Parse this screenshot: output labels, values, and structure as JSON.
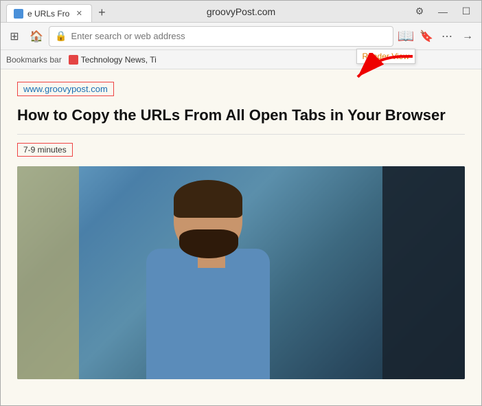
{
  "browser": {
    "title": "groovyPost.com",
    "tab": {
      "title": "e URLs Fro",
      "favicon_color": "#4a90d9"
    },
    "new_tab_label": "+",
    "window_controls": {
      "minimize": "—",
      "maximize": "☐",
      "restore": ""
    }
  },
  "toolbar": {
    "grid_icon": "⊞",
    "home_icon": "⌂",
    "address_placeholder": "Enter search or web address",
    "reader_view_icon": "📖",
    "reader_view_tooltip": "Reader View",
    "bookmark_icon": "🔖",
    "more_icon": "⋯",
    "forward_icon": "→"
  },
  "bookmarks_bar": {
    "label": "Bookmarks bar",
    "items": [
      {
        "label": "Technology News, Ti",
        "favicon_color": "#e44444"
      }
    ]
  },
  "article": {
    "url": "www.groovypost.com",
    "title": "How to Copy the URLs From All Open Tabs in Your Browser",
    "read_time": "7-9 minutes"
  },
  "arrow": {
    "points_to": "reader-view-button"
  }
}
